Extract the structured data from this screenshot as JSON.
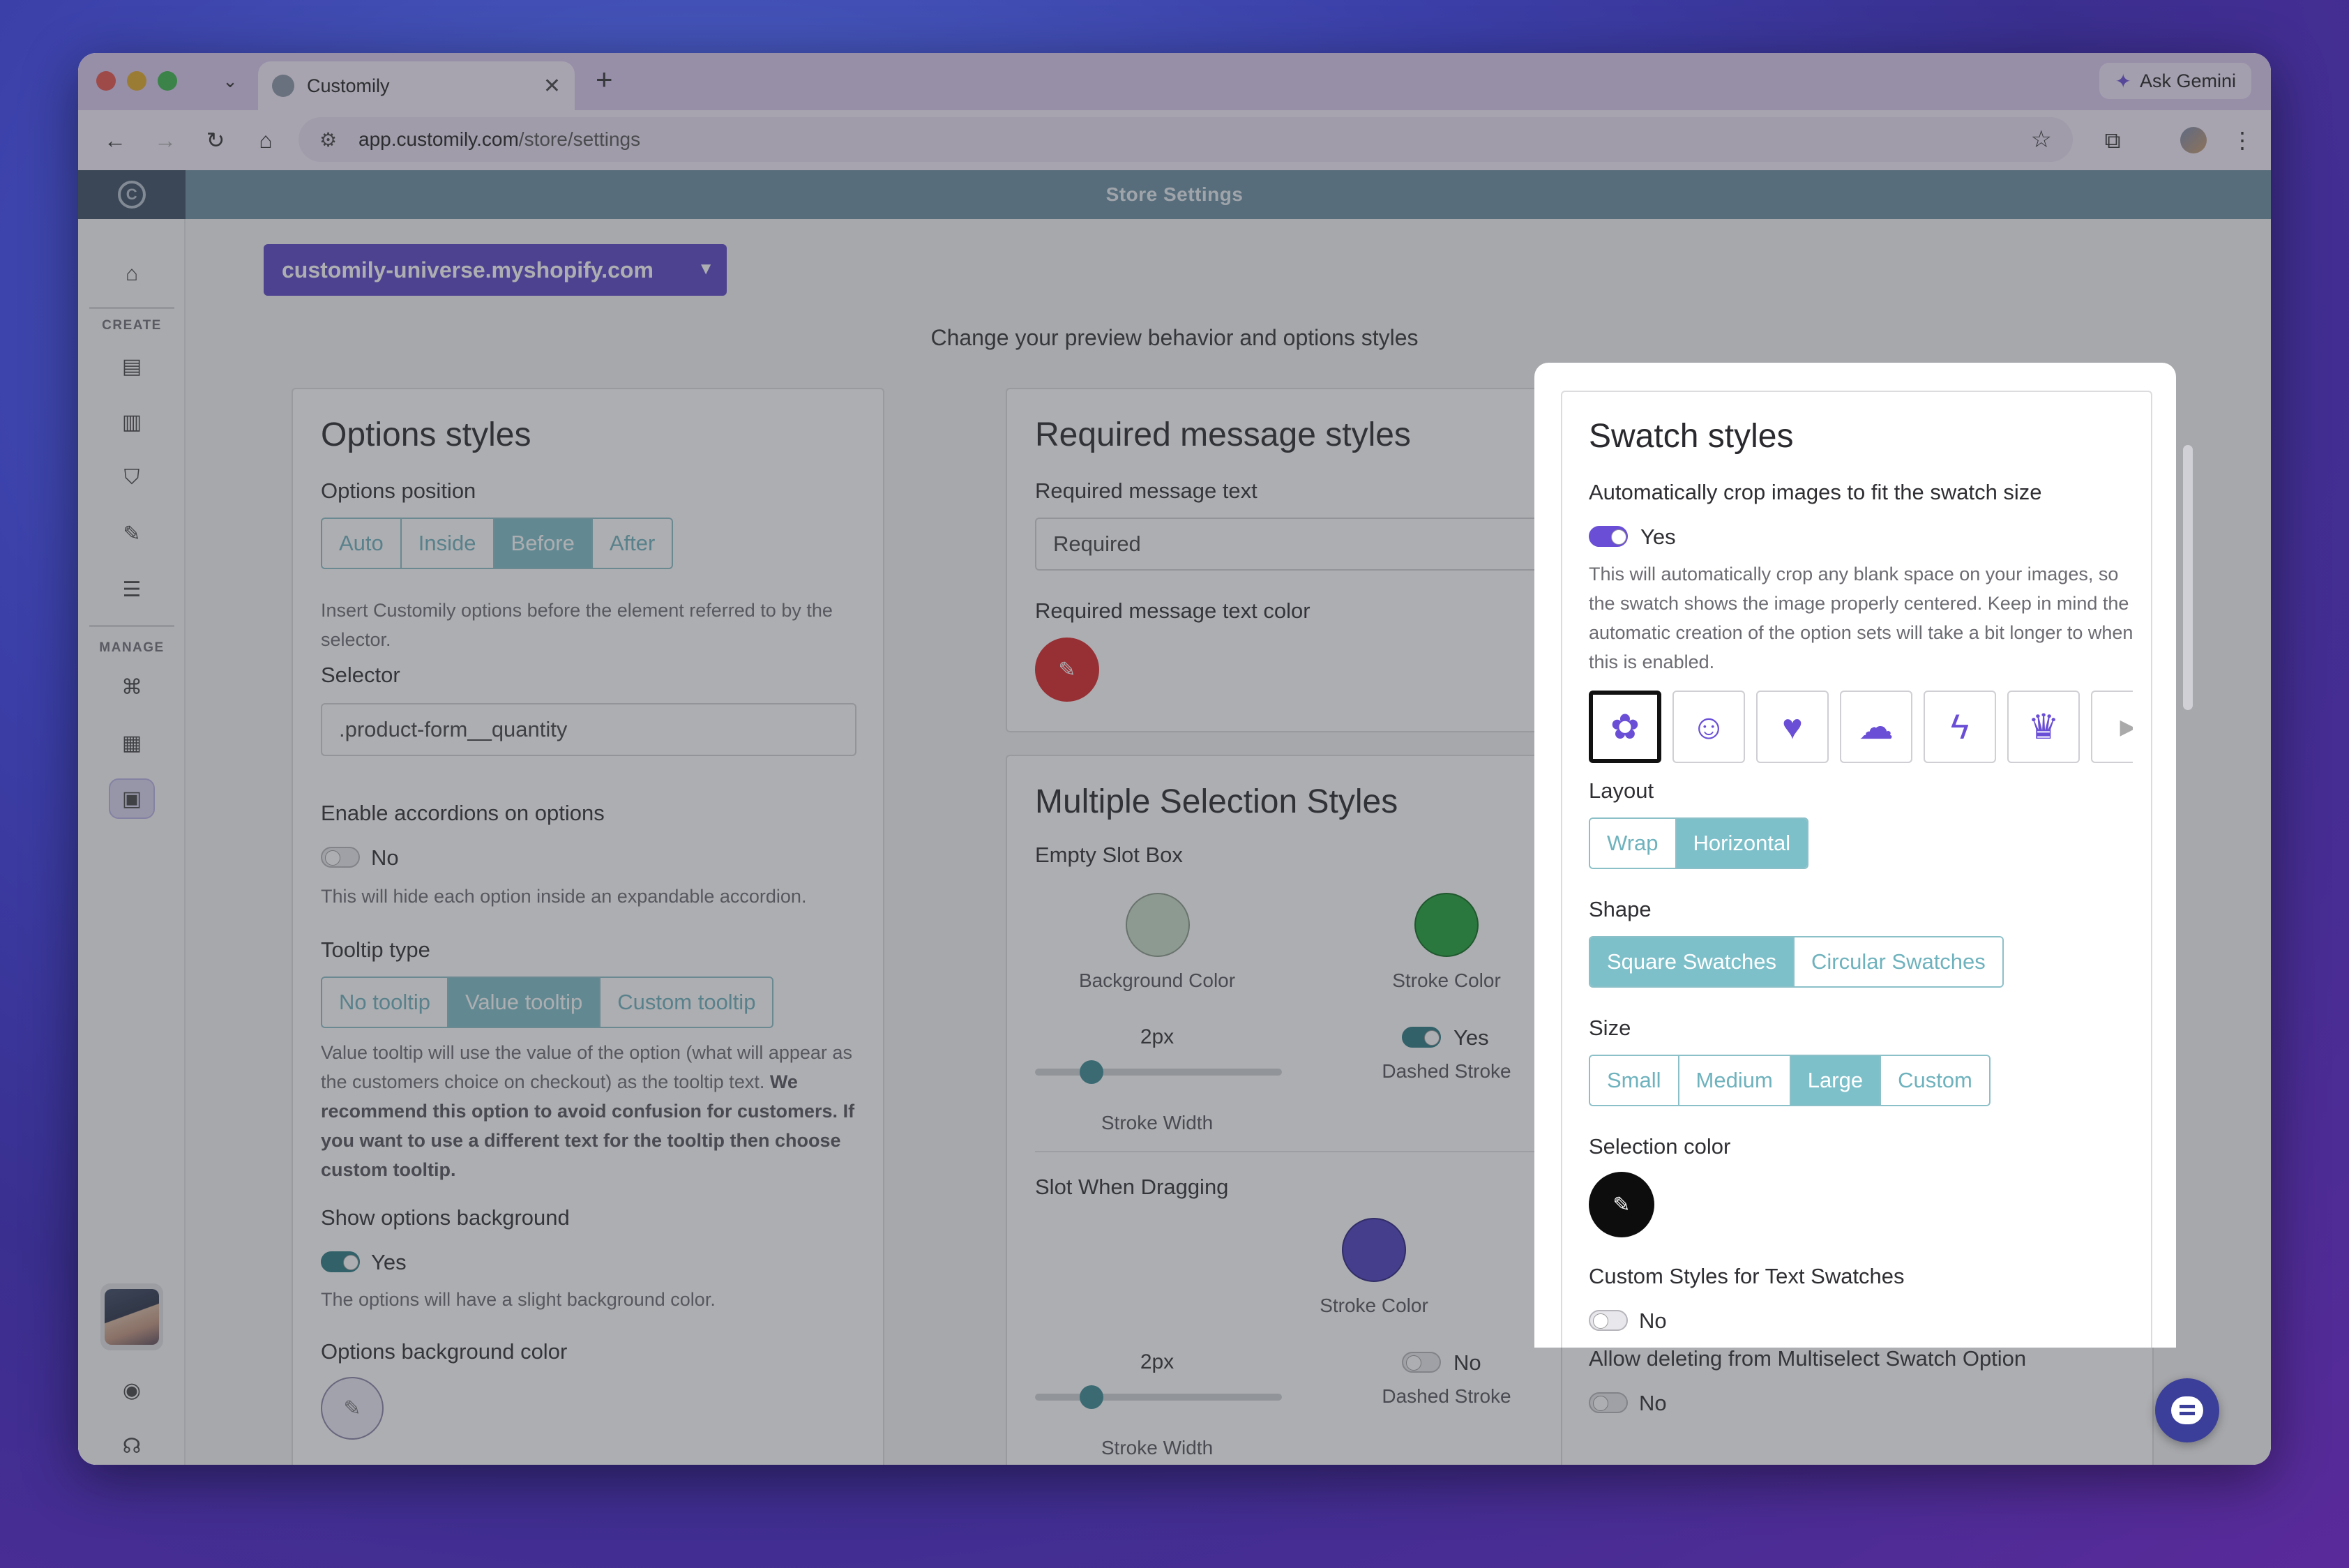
{
  "browser": {
    "tab_title": "Customily",
    "url_domain": "app.customily.com",
    "url_path": "/store/settings",
    "gemini_label": "Ask Gemini"
  },
  "header": {
    "title": "Store Settings"
  },
  "sidebar": {
    "create_label": "CREATE",
    "manage_label": "MANAGE"
  },
  "store_selector": {
    "value": "customily-universe.myshopify.com"
  },
  "subtitle": "Change your preview behavior and options styles",
  "options_styles": {
    "title": "Options styles",
    "position_label": "Options position",
    "position_options": [
      "Auto",
      "Inside",
      "Before",
      "After"
    ],
    "position_selected": "Before",
    "position_help": "Insert Customily options before the element referred to by the selector.",
    "selector_label": "Selector",
    "selector_value": ".product-form__quantity",
    "accordion_label": "Enable accordions on options",
    "accordion_value": "No",
    "accordion_help": "This will hide each option inside an expandable accordion.",
    "tooltip_label": "Tooltip type",
    "tooltip_options": [
      "No tooltip",
      "Value tooltip",
      "Custom tooltip"
    ],
    "tooltip_selected": "Value tooltip",
    "tooltip_help_1": "Value tooltip will use the value of the option (what will appear as the customers choice on checkout) as the tooltip text.",
    "tooltip_help_bold": "We recommend this option to avoid confusion for customers. If you want to use a different text for the tooltip then choose custom tooltip.",
    "bg_label": "Show options background",
    "bg_value": "Yes",
    "bg_help": "The options will have a slight background color.",
    "bg_color_label": "Options background color"
  },
  "required_styles": {
    "title": "Required message styles",
    "text_label": "Required message text",
    "text_value": "Required",
    "color_label": "Required message text color",
    "color": "#d9262a"
  },
  "multi_select": {
    "title": "Multiple Selection Styles",
    "empty_label": "Empty Slot Box",
    "bg_color_label": "Background Color",
    "stroke_color_label": "Stroke Color",
    "stroke_width_value": "2px",
    "stroke_width_label": "Stroke Width",
    "stroke_width_fraction": 0.23,
    "dashed_value": "Yes",
    "dashed_label": "Dashed Stroke",
    "dragging_label": "Slot When Dragging",
    "drag_stroke_color_label": "Stroke Color",
    "drag_width_value": "2px",
    "drag_width_label": "Stroke Width",
    "drag_width_fraction": 0.23,
    "drag_dashed_value": "No",
    "drag_dashed_label": "Dashed Stroke",
    "empty_bg_color": "#c9dcc9",
    "empty_stroke_color": "#20a33a",
    "drag_stroke_color": "#4c3fc0"
  },
  "swatch_styles": {
    "title": "Swatch styles",
    "crop_label": "Automatically crop images to fit the swatch size",
    "crop_value": "Yes",
    "crop_help": "This will automatically crop any blank space on your images, so the swatch shows the image properly centered. Keep in mind the automatic creation of the option sets will take a bit longer to when this is enabled.",
    "icons": [
      "flower-icon",
      "smiley-icon",
      "heart-icon",
      "cloud-icon",
      "bolt-icon",
      "trophy-icon"
    ],
    "layout_label": "Layout",
    "layout_options": [
      "Wrap",
      "Horizontal"
    ],
    "layout_selected": "Horizontal",
    "shape_label": "Shape",
    "shape_options": [
      "Square Swatches",
      "Circular Swatches"
    ],
    "shape_selected": "Square Swatches",
    "size_label": "Size",
    "size_options": [
      "Small",
      "Medium",
      "Large",
      "Custom"
    ],
    "size_selected": "Large",
    "selection_color_label": "Selection color",
    "text_swatch_label": "Custom Styles for Text Swatches",
    "text_swatch_value": "No",
    "allow_delete_label": "Allow deleting from Multiselect Swatch Option",
    "allow_delete_value": "No"
  }
}
